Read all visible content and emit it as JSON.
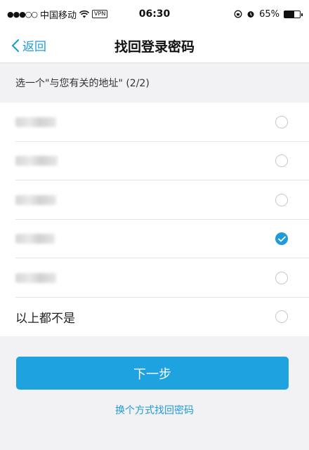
{
  "status_bar": {
    "signal": "●●●○○",
    "carrier": "中国移动",
    "vpn": "VPN",
    "time": "06:30",
    "battery": "65%",
    "battery_level": 0.65
  },
  "nav": {
    "back_label": "返回",
    "title": "找回登录密码"
  },
  "section": {
    "prompt": "选一个\"与您有关的地址\" (2/2)"
  },
  "options": [
    {
      "label": "",
      "obscured": true,
      "checked": false
    },
    {
      "label": "",
      "obscured": true,
      "checked": false
    },
    {
      "label": "",
      "obscured": true,
      "checked": false
    },
    {
      "label": "",
      "obscured": true,
      "checked": true
    },
    {
      "label": "",
      "obscured": true,
      "checked": false
    },
    {
      "label": "以上都不是",
      "obscured": false,
      "checked": false
    }
  ],
  "actions": {
    "next_label": "下一步",
    "alt_link": "换个方式找回密码"
  },
  "colors": {
    "accent": "#1f9bd8",
    "button": "#1ea2e0"
  }
}
